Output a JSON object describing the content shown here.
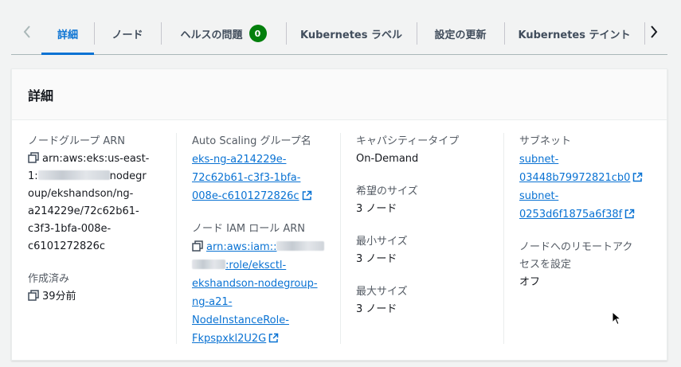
{
  "tabs": {
    "details": "詳細",
    "nodes": "ノード",
    "health": "ヘルスの問題",
    "health_count": "0",
    "k8s_labels": "Kubernetes ラベル",
    "config_update": "設定の更新",
    "k8s_taints": "Kubernetes テイント"
  },
  "panel": {
    "title": "詳細"
  },
  "fields": {
    "arn_label": "ノードグループ ARN",
    "arn_lines": [
      "arn:aws:eks:us-east-",
      "1:",
      "nodegr",
      "oup/ekshandson/ng-",
      "a214229e/72c62b61-",
      "c3f3-1bfa-008e-",
      "c6101272826c"
    ],
    "created_label": "作成済み",
    "created_value": "39分前",
    "asg_label": "Auto Scaling グループ名",
    "asg_lines": [
      "eks-ng-a214229e-",
      "72c62b61-c3f3-1bfa-",
      "008e-c6101272826c"
    ],
    "iam_label": "ノード IAM ロール ARN",
    "iam_lines": [
      "arn:aws:iam::",
      ":role/eksctl-",
      "ekshandson-nodegroup-",
      "ng-a21-",
      "NodeInstanceRole-",
      "Fkpspxkl2U2G"
    ],
    "capacity_label": "キャパシティータイプ",
    "capacity_value": "On-Demand",
    "desired_label": "希望のサイズ",
    "desired_value": "3 ノード",
    "min_label": "最小サイズ",
    "min_value": "3 ノード",
    "max_label": "最大サイズ",
    "max_value": "3 ノード",
    "subnet_label": "サブネット",
    "subnet1_lines": [
      "subnet-",
      "03448b79972821cb0"
    ],
    "subnet2_lines": [
      "subnet-",
      "0253d6f1875a6f38f"
    ],
    "remote_label_lines": [
      "ノードへのリモートアク",
      "セスを設定"
    ],
    "remote_value": "オフ"
  },
  "colors": {
    "accent": "#0972d3",
    "badge_green": "#037f0c",
    "label_gray": "#545b64"
  }
}
